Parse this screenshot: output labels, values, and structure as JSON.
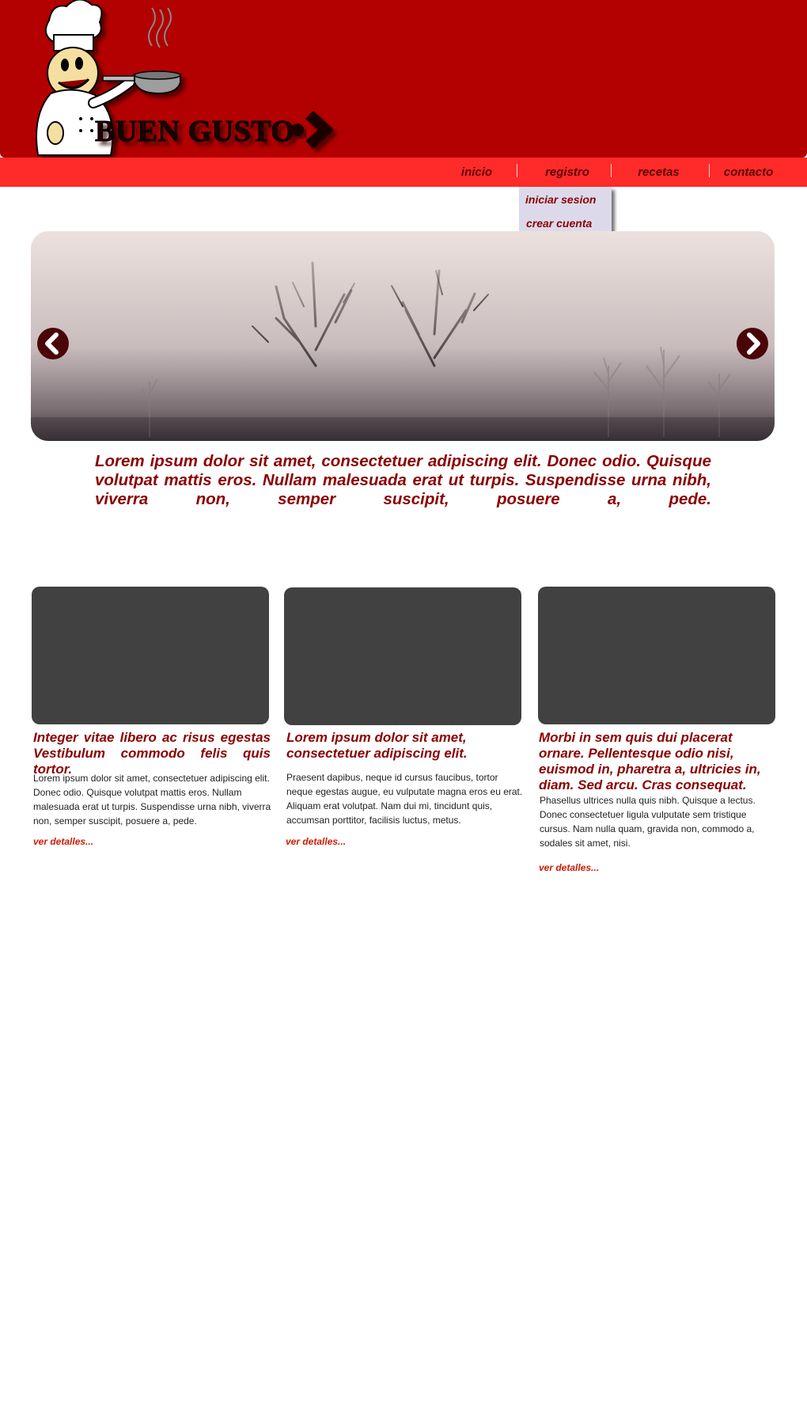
{
  "brand": {
    "name": "BUEN GUSTO"
  },
  "nav": {
    "items": [
      {
        "label": "inicio"
      },
      {
        "label": "registro"
      },
      {
        "label": "recetas"
      },
      {
        "label": "contacto"
      }
    ]
  },
  "registro_menu": {
    "items": [
      {
        "label": "iniciar sesion"
      },
      {
        "label": "crear cuenta"
      }
    ]
  },
  "intro": {
    "text": "Lorem ipsum dolor sit amet, consectetuer adipiscing elit. Donec odio. Quisque volutpat mattis eros. Nullam malesuada erat ut turpis. Suspendisse urna nibh, viverra non, semper suscipit, posuere a, pede."
  },
  "cards": [
    {
      "title": "Integer vitae libero ac risus egestas Vestibulum commodo felis quis tortor.",
      "text": "Lorem ipsum dolor sit amet, consectetuer adipiscing elit. Donec odio. Quisque volutpat mattis eros. Nullam malesuada erat ut turpis. Suspendisse urna nibh, viverra non, semper suscipit, posuere a, pede.",
      "link": "ver detalles..."
    },
    {
      "title": "Lorem ipsum dolor sit amet, consectetuer adipiscing elit.",
      "text": "Praesent dapibus, neque id cursus faucibus, tortor neque egestas augue, eu vulputate magna eros eu erat. Aliquam erat volutpat. Nam dui mi, tincidunt quis, accumsan porttitor, facilisis luctus, metus.",
      "link": "ver detalles..."
    },
    {
      "title": "Morbi in sem quis dui placerat ornare. Pellentesque odio nisi, euismod in, pharetra a, ultricies in, diam. Sed arcu. Cras consequat.",
      "text": "Phasellus ultrices nulla quis nibh. Quisque a lectus. Donec consectetuer ligula vulputate sem tristique cursus. Nam nulla quam, gravida non, commodo a, sodales sit amet, nisi.",
      "link": "ver detalles..."
    }
  ],
  "colors": {
    "header_bg": "#b30000",
    "nav_bg": "#ff2a2a",
    "accent_text": "#8b0000",
    "link": "#cc1b00",
    "dropdown_bg": "#dcdaea",
    "card_placeholder": "#414141"
  },
  "icons": {
    "logo": "chef-with-pan-icon",
    "slider_prev": "chevron-left-icon",
    "slider_next": "chevron-right-icon"
  }
}
